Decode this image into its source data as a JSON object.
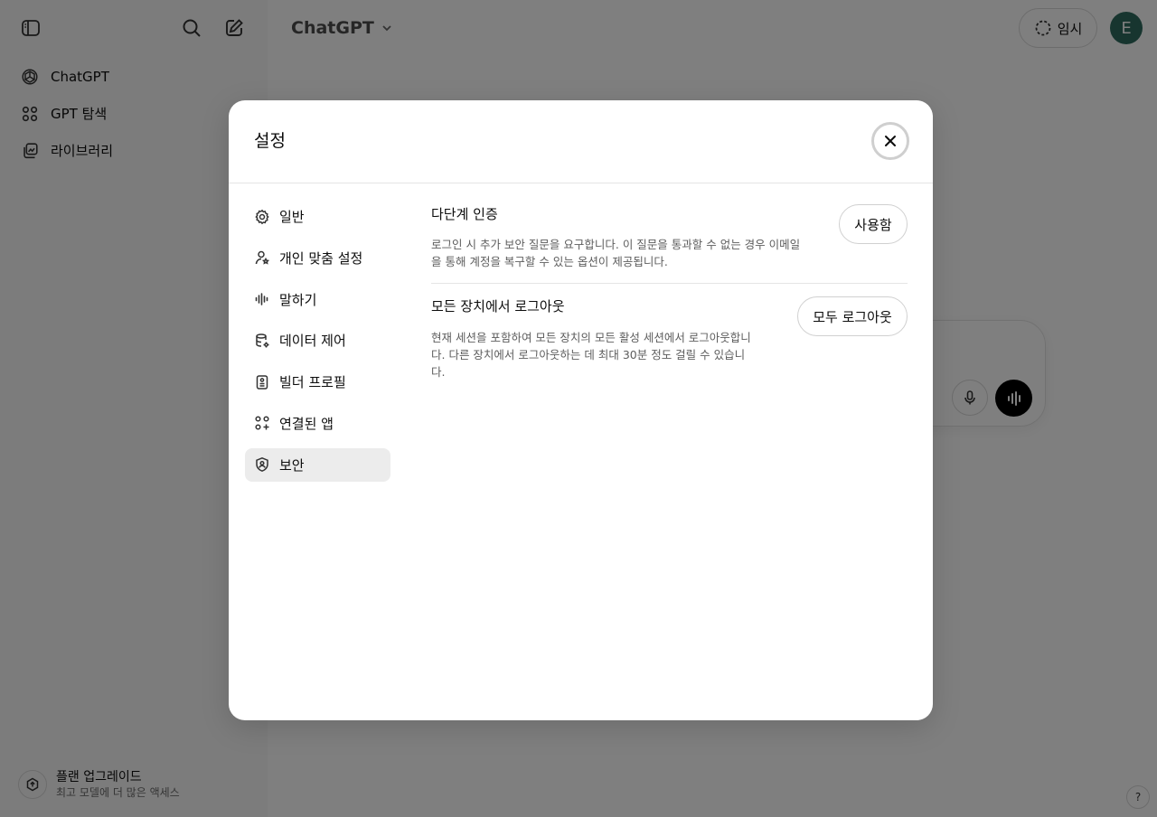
{
  "sidebar": {
    "nav": [
      {
        "label": "ChatGPT",
        "icon": "openai-logo-icon"
      },
      {
        "label": "GPT 탐색",
        "icon": "grid-icon"
      },
      {
        "label": "라이브러리",
        "icon": "library-icon"
      }
    ],
    "upgrade": {
      "title": "플랜 업그레이드",
      "subtitle": "최고 모델에 더 많은 액세스"
    }
  },
  "header": {
    "model": "ChatGPT",
    "temporary_label": "임시",
    "avatar_initial": "E"
  },
  "help_label": "?",
  "settings": {
    "title": "설정",
    "tabs": [
      {
        "label": "일반",
        "icon": "gear-icon"
      },
      {
        "label": "개인 맞춤 설정",
        "icon": "personalization-icon"
      },
      {
        "label": "말하기",
        "icon": "waveform-icon"
      },
      {
        "label": "데이터 제어",
        "icon": "database-icon"
      },
      {
        "label": "빌더 프로필",
        "icon": "id-badge-icon"
      },
      {
        "label": "연결된 앱",
        "icon": "apps-icon"
      },
      {
        "label": "보안",
        "icon": "shield-icon",
        "active": true
      }
    ],
    "security": {
      "mfa": {
        "title": "다단계 인증",
        "description": "로그인 시 추가 보안 질문을 요구합니다. 이 질문을 통과할 수 없는 경우 이메일을 통해 계정을 복구할 수 있는 옵션이 제공됩니다.",
        "button": "사용함"
      },
      "logout_all": {
        "title": "모든 장치에서 로그아웃",
        "description": "현재 세션을 포함하여 모든 장치의 모든 활성 세션에서 로그아웃합니다. 다른 장치에서 로그아웃하는 데 최대 30분 정도 걸릴 수 있습니다.",
        "button": "모두 로그아웃"
      }
    }
  }
}
